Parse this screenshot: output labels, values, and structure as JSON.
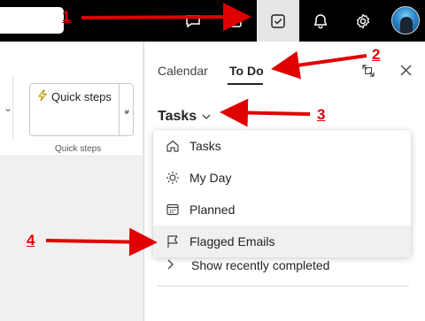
{
  "topbar": {
    "icons": [
      "chat-icon",
      "todo-icon",
      "bell-icon",
      "gear-icon"
    ],
    "active": "todo-icon"
  },
  "ribbon": {
    "quick_steps_label": "Quick steps",
    "quick_steps_caption": "Quick steps"
  },
  "panel": {
    "tabs": [
      {
        "label": "Calendar"
      },
      {
        "label": "To Do",
        "selected": true
      }
    ],
    "tasks_header": "Tasks",
    "dropdown": [
      {
        "label": "Tasks",
        "icon": "home-icon"
      },
      {
        "label": "My Day",
        "icon": "sun-icon"
      },
      {
        "label": "Planned",
        "icon": "calendar-grid-icon"
      },
      {
        "label": "Flagged Emails",
        "icon": "flag-icon",
        "highlighted": true
      }
    ],
    "show_completed": "Show recently completed"
  },
  "annotations": [
    "1",
    "2",
    "3",
    "4"
  ],
  "colors": {
    "annotation": "#e00000",
    "topbar": "#000000",
    "active_button": "#e6e6e6"
  }
}
